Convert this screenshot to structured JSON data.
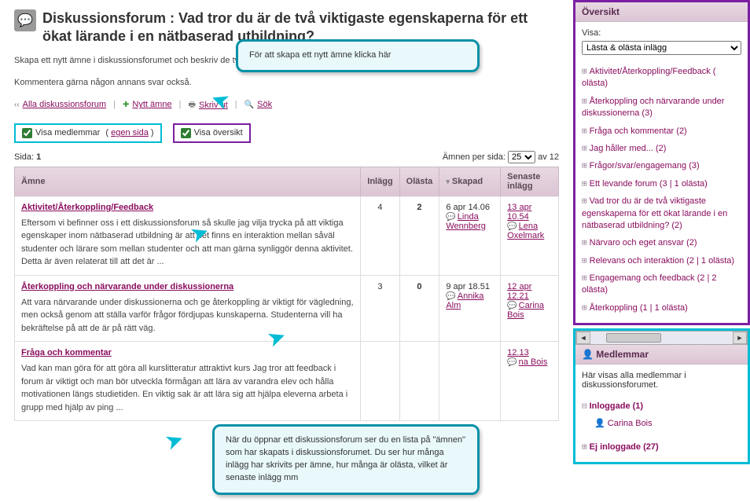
{
  "header": {
    "title": "Diskussionsforum : Vad tror du är de två viktigaste egenskaperna för ett ökat lärande i en nätbaserad utbildning?",
    "desc1": "Skapa ett nytt ämne i diskussionsforumet och beskriv de två viktigaste egenskaperna och varför dessa är viktigast.",
    "desc2": "Kommentera gärna någon annans svar också."
  },
  "toolbar": {
    "all_forums": "Alla diskussionsforum",
    "new_topic": "Nytt ämne",
    "print": "Skriv ut",
    "search": "Sök",
    "back_glyph": "‹‹",
    "plus_glyph": "✚",
    "print_glyph": "🖶",
    "search_glyph": "🔍"
  },
  "opts": {
    "show_members": "Visa medlemmar",
    "own_page": "egen sida",
    "show_overview": "Visa översikt"
  },
  "pager": {
    "side_label": "Sida:",
    "side_value": "1",
    "per_page_label": "Ämnen per sida:",
    "per_page_value": "25",
    "of_text": "av 12"
  },
  "table": {
    "col_topic": "Ämne",
    "col_posts": "Inlägg",
    "col_unread": "Olästa",
    "col_created": "Skapad",
    "col_latest": "Senaste inlägg",
    "rows": [
      {
        "title": "Aktivitet/Återkoppling/Feedback",
        "body": "Eftersom vi befinner oss i ett diskussionsforum så skulle jag vilja trycka på att viktiga egenskaper inom nätbaserad utbildning är att det finns en interaktion mellan såväl studenter och lärare som mellan studenter och att man gärna synliggör denna aktivitet. Detta är även relaterat till att det är ...",
        "posts": "4",
        "unread": "2",
        "created_date": "6 apr 14.06",
        "created_by": "Linda Wennberg",
        "latest_date": "13 apr 10.54",
        "latest_by": "Lena Oxelmark"
      },
      {
        "title": "Återkoppling och närvarande under diskussionerna",
        "body": "Att vara närvarande under diskussionerna och ge återkoppling är viktigt för vägledning, men också genom att ställa varför frågor fördjupas kunskaperna. Studenterna vill ha bekräftelse på att de är på rätt väg.",
        "posts": "3",
        "unread": "0",
        "created_date": "9 apr 18.51",
        "created_by": "Annika Alm",
        "latest_date": "12 apr 12.21",
        "latest_by": "Carina Bois"
      },
      {
        "title": "Fråga och kommentar",
        "body": "Vad kan man göra för att göra all kurslitteratur attraktivt kurs Jag tror att feedback i forum är viktigt och man bör utveckla förmågan att lära av varandra elev och hålla motivationen längs studietiden. En viktig sak är att lära sig att hjälpa eleverna arbeta i grupp med hjälp av ping ...",
        "posts": "",
        "unread": "",
        "created_date": "",
        "created_by": "",
        "latest_date": "12.13",
        "latest_by": "na Bois"
      }
    ]
  },
  "callouts": {
    "top": "För att skapa ett nytt ämne klicka här",
    "mid": "När du öppnar ett diskussionsforum ser du en lista på \"ämnen\" som har skapats i diskussionsforumet. Du ser hur många inlägg har skrivits per ämne, hur många är olästa, vilket är senaste inlägg mm"
  },
  "sidebar": {
    "overview": {
      "title": "Översikt",
      "show_label": "Visa:",
      "show_value": "Lästa & olästa inlägg",
      "items": [
        "Aktivitet/Återkoppling/Feedback ( olästa)",
        "Återkoppling och närvarande under diskussionerna (3)",
        "Fråga och kommentar  (2)",
        "Jag håller med... (2)",
        "Frågor/svar/engagemang (3)",
        "Ett levande forum (3 | 1 olästa)",
        "Vad tror du är de två viktigaste egenskaperna för ett ökat lärande i en nätbaserad utbildning?  (2)",
        "Närvaro och eget ansvar (2)",
        "Relevans och interaktion (2 | 1 olästa)",
        "Engagemang och feedback (2 | 2 olästa)",
        "Återkoppling (1 | 1 olästa)"
      ]
    },
    "members": {
      "title": "Medlemmar",
      "desc": "Här visas alla medlemmar i diskussionsforumet.",
      "logged_in_label": "Inloggade (1)",
      "logged_in_user": "Carina Bois",
      "logged_out_label": "Ej inloggade (27)"
    },
    "person_glyph": "👤"
  }
}
